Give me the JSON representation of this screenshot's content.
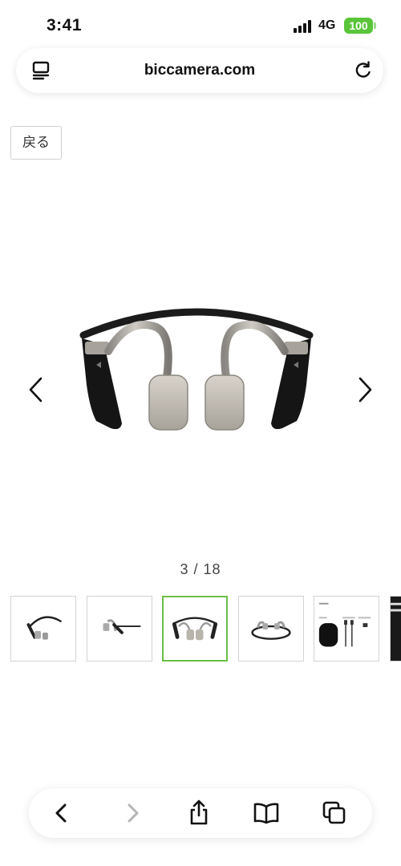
{
  "status_bar": {
    "time": "3:41",
    "network": "4G",
    "battery": "100",
    "battery_color": "#5ac53a"
  },
  "browser": {
    "url": "biccamera.com"
  },
  "page": {
    "back_label": "戻る"
  },
  "gallery": {
    "counter": "3 / 18",
    "accent_color": "#6abf45",
    "thumbnails": [
      {
        "name": "headphones-angle-view",
        "active": false
      },
      {
        "name": "headphones-side-view",
        "active": false
      },
      {
        "name": "headphones-front-view",
        "active": true
      },
      {
        "name": "headphones-top-view",
        "active": false
      },
      {
        "name": "package-contents",
        "active": false
      },
      {
        "name": "headphones-detail",
        "active": false
      }
    ]
  },
  "toolbar": {
    "buttons": [
      "back-icon",
      "forward-icon",
      "share-icon",
      "bookmarks-icon",
      "tabs-icon"
    ]
  }
}
